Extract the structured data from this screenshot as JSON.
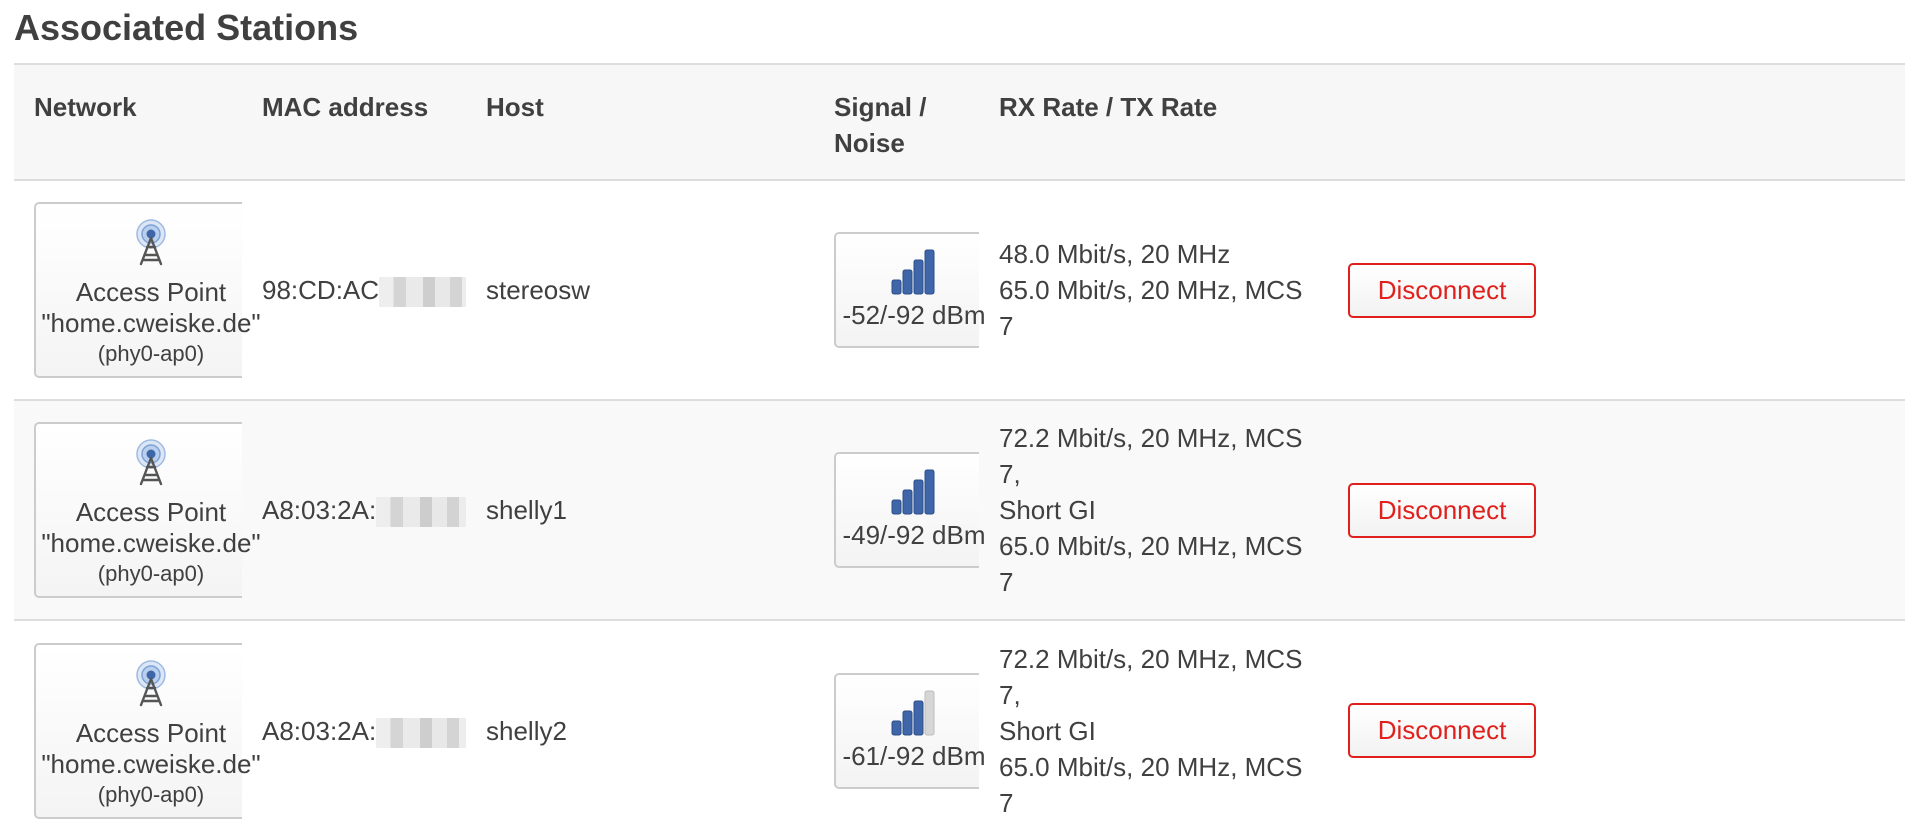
{
  "page": {
    "title": "Associated Stations"
  },
  "table": {
    "columns": {
      "network": "Network",
      "mac": "MAC address",
      "host": "Host",
      "signal_line1": "Signal /",
      "signal_line2": "Noise",
      "rate": "RX Rate / TX Rate"
    },
    "rows": [
      {
        "network": {
          "icon": "access-point-icon",
          "line1": "Access Point",
          "line2": "\"home.cweiske.de\"",
          "line3": "(phy0-ap0)"
        },
        "mac_visible": "98:CD:AC",
        "host": "stereosw",
        "signal": {
          "label": "-52/-92 dBm",
          "bars_filled": 4,
          "bars_total": 4
        },
        "rx_rate": [
          "48.0 Mbit/s, 20 MHz"
        ],
        "tx_rate": "65.0 Mbit/s, 20 MHz, MCS 7",
        "action": "Disconnect"
      },
      {
        "network": {
          "icon": "access-point-icon",
          "line1": "Access Point",
          "line2": "\"home.cweiske.de\"",
          "line3": "(phy0-ap0)"
        },
        "mac_visible": "A8:03:2A:",
        "host": "shelly1",
        "signal": {
          "label": "-49/-92 dBm",
          "bars_filled": 4,
          "bars_total": 4
        },
        "rx_rate": [
          "72.2 Mbit/s, 20 MHz, MCS 7,",
          "Short GI"
        ],
        "tx_rate": "65.0 Mbit/s, 20 MHz, MCS 7",
        "action": "Disconnect"
      },
      {
        "network": {
          "icon": "access-point-icon",
          "line1": "Access Point",
          "line2": "\"home.cweiske.de\"",
          "line3": "(phy0-ap0)"
        },
        "mac_visible": "A8:03:2A:",
        "host": "shelly2",
        "signal": {
          "label": "-61/-92 dBm",
          "bars_filled": 3,
          "bars_total": 4
        },
        "rx_rate": [
          "72.2 Mbit/s, 20 MHz, MCS 7,",
          "Short GI"
        ],
        "tx_rate": "65.0 Mbit/s, 20 MHz, MCS 7",
        "action": "Disconnect"
      }
    ]
  },
  "colors": {
    "disconnect": "#e0201c",
    "signal_bar": "#3f66a8",
    "signal_bar_empty": "#d6d6d6"
  }
}
